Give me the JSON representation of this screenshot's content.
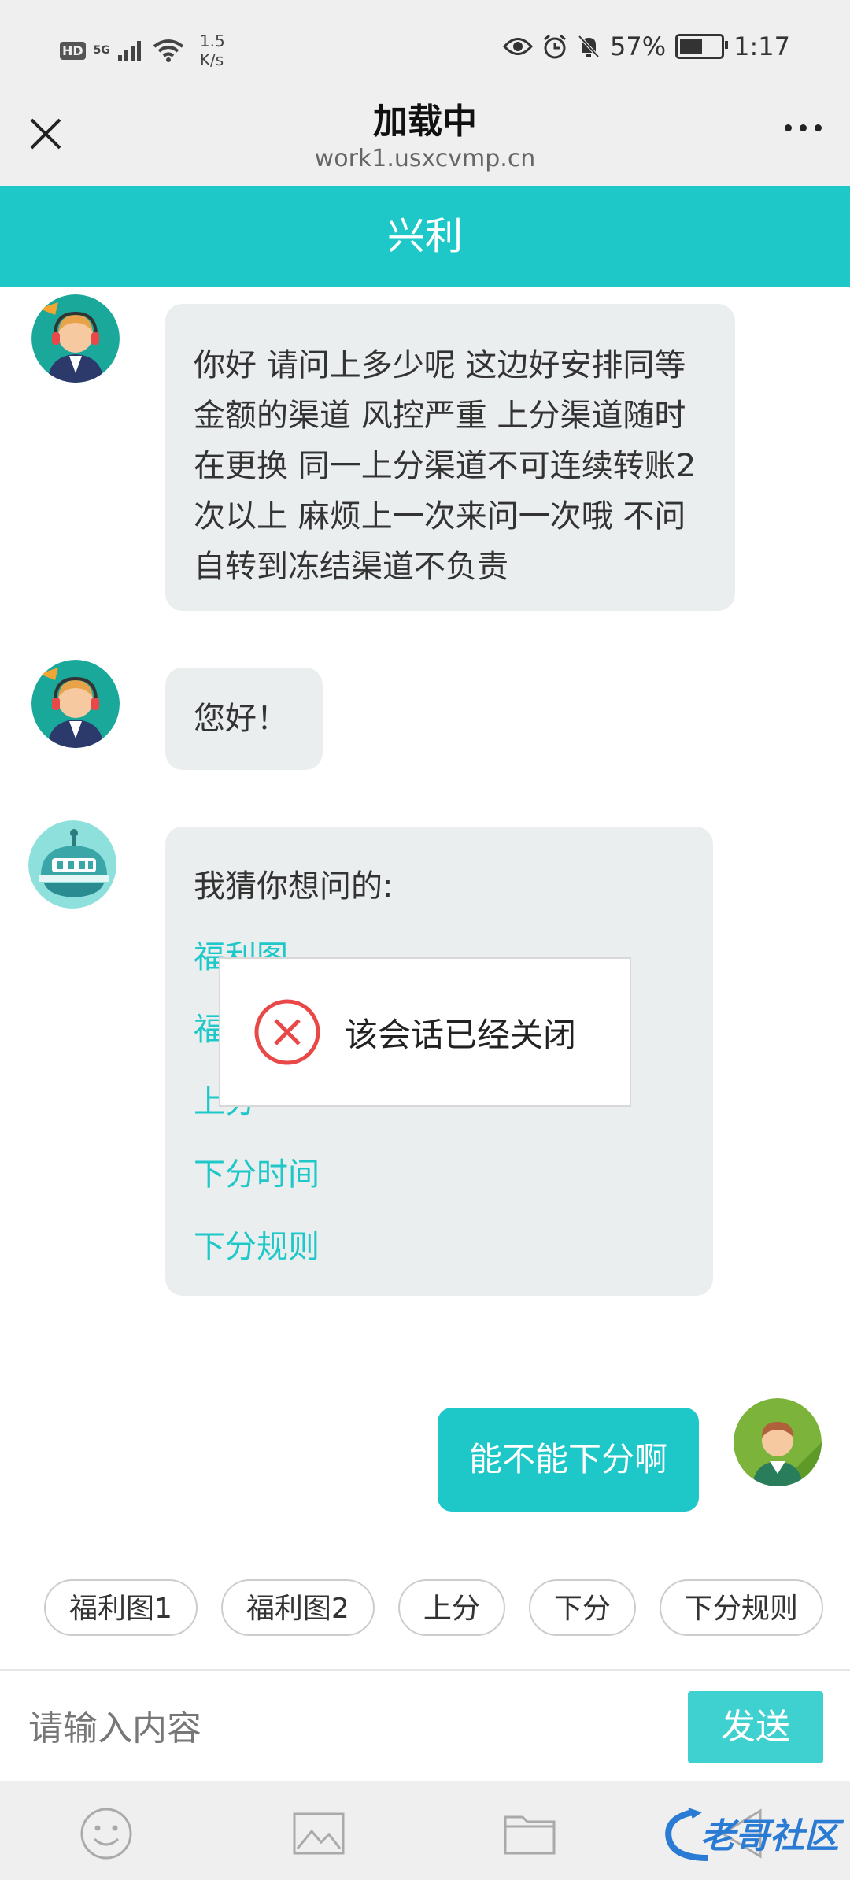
{
  "status_bar": {
    "badge": "HD",
    "network": "5G",
    "speed": "1.5\nK/s",
    "battery": "57%",
    "battery_fill_fraction": 0.57,
    "time": "1:17"
  },
  "title_bar": {
    "title": "加载中",
    "url": "work1.usxcvmp.cn"
  },
  "chat": {
    "header_title": "兴利",
    "messages": [
      {
        "from": "agent",
        "text": "你好 请问上多少呢 这边好安排同等金额的渠道 风控严重 上分渠道随时在更换 同一上分渠道不可连续转账2次以上 麻烦上一次来问一次哦 不问自转到冻结渠道不负责"
      },
      {
        "from": "agent",
        "text": "您好！"
      },
      {
        "from": "bot",
        "title": "我猜你想问的:",
        "faq": [
          "福利图",
          "福",
          "上分",
          "下分时间",
          "下分规则"
        ]
      },
      {
        "from": "user",
        "text": "能不能下分啊"
      }
    ]
  },
  "modal": {
    "text": "该会话已经关闭"
  },
  "quick_replies": [
    "福利图1",
    "福利图2",
    "上分",
    "下分",
    "下分规则"
  ],
  "input": {
    "placeholder": "请输入内容",
    "value": "",
    "send_label": "发送"
  },
  "toolbar": {
    "icons": [
      "emoji-icon",
      "image-icon",
      "folder-icon",
      "back-icon"
    ]
  },
  "watermark": {
    "text": "老哥社区"
  },
  "colors": {
    "accent": "#1ec8c8",
    "bubble": "#ebeeef",
    "error": "#e84848"
  }
}
